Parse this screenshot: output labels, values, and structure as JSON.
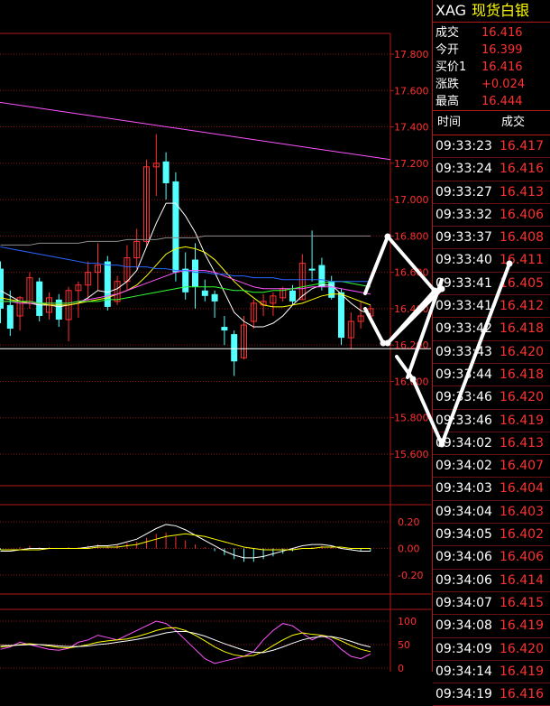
{
  "header": {
    "symbol": "XAG",
    "name": "现货白银"
  },
  "quote": [
    {
      "label": "成交",
      "value": "16.416"
    },
    {
      "label": "今开",
      "value": "16.399"
    },
    {
      "label": "买价1",
      "value": "16.416"
    },
    {
      "label": "涨跌",
      "value": "+0.024"
    },
    {
      "label": "最高",
      "value": "16.444"
    }
  ],
  "ticks_header": {
    "time": "时间",
    "price": "成交"
  },
  "ticks": [
    {
      "time": "09:33:23",
      "price": "16.417"
    },
    {
      "time": "09:33:24",
      "price": "16.416"
    },
    {
      "time": "09:33:27",
      "price": "16.413"
    },
    {
      "time": "09:33:32",
      "price": "16.406"
    },
    {
      "time": "09:33:37",
      "price": "16.408"
    },
    {
      "time": "09:33:40",
      "price": "16.411"
    },
    {
      "time": "09:33:41",
      "price": "16.405"
    },
    {
      "time": "09:33:41",
      "price": "16.412"
    },
    {
      "time": "09:33:42",
      "price": "16.418"
    },
    {
      "time": "09:33:43",
      "price": "16.420"
    },
    {
      "time": "09:33:44",
      "price": "16.418"
    },
    {
      "time": "09:33:46",
      "price": "16.420"
    },
    {
      "time": "09:33:46",
      "price": "16.419"
    },
    {
      "time": "09:34:02",
      "price": "16.413"
    },
    {
      "time": "09:34:02",
      "price": "16.407"
    },
    {
      "time": "09:34:03",
      "price": "16.404"
    },
    {
      "time": "09:34:04",
      "price": "16.403"
    },
    {
      "time": "09:34:05",
      "price": "16.402"
    },
    {
      "time": "09:34:06",
      "price": "16.406"
    },
    {
      "time": "09:34:06",
      "price": "16.414"
    },
    {
      "time": "09:34:07",
      "price": "16.415"
    },
    {
      "time": "09:34:08",
      "price": "16.419"
    },
    {
      "time": "09:34:09",
      "price": "16.420"
    },
    {
      "time": "09:34:14",
      "price": "16.419"
    },
    {
      "time": "09:34:19",
      "price": "16.416"
    }
  ],
  "chart_data": [
    {
      "type": "candlestick",
      "y_ticks": [
        "17.800",
        "17.600",
        "17.400",
        "17.200",
        "17.000",
        "16.800",
        "16.600",
        "16.400",
        "16.200",
        "16.000",
        "15.800",
        "15.600"
      ],
      "ylim": [
        15.5,
        17.95
      ],
      "colors": {
        "up": "#ff3030",
        "down": "#54ffff",
        "grid": "#8a1414"
      },
      "candles": [
        {
          "o": 16.62,
          "h": 16.66,
          "c": 16.4,
          "l": 16.32
        },
        {
          "o": 16.42,
          "h": 16.5,
          "c": 16.29,
          "l": 16.25
        },
        {
          "o": 16.36,
          "h": 16.47,
          "c": 16.46,
          "l": 16.28
        },
        {
          "o": 16.44,
          "h": 16.6,
          "c": 16.57,
          "l": 16.4
        },
        {
          "o": 16.55,
          "h": 16.57,
          "c": 16.36,
          "l": 16.33
        },
        {
          "o": 16.38,
          "h": 16.49,
          "c": 16.46,
          "l": 16.34
        },
        {
          "o": 16.45,
          "h": 16.48,
          "c": 16.34,
          "l": 16.3
        },
        {
          "o": 16.34,
          "h": 16.52,
          "c": 16.5,
          "l": 16.22
        },
        {
          "o": 16.5,
          "h": 16.55,
          "c": 16.53,
          "l": 16.35
        },
        {
          "o": 16.53,
          "h": 16.66,
          "c": 16.6,
          "l": 16.44
        },
        {
          "o": 16.6,
          "h": 16.76,
          "c": 16.64,
          "l": 16.5
        },
        {
          "o": 16.66,
          "h": 16.69,
          "c": 16.41,
          "l": 16.39
        },
        {
          "o": 16.44,
          "h": 16.58,
          "c": 16.55,
          "l": 16.42
        },
        {
          "o": 16.55,
          "h": 16.75,
          "c": 16.68,
          "l": 16.5
        },
        {
          "o": 16.68,
          "h": 16.84,
          "c": 16.77,
          "l": 16.62
        },
        {
          "o": 16.77,
          "h": 17.22,
          "c": 17.18,
          "l": 16.74
        },
        {
          "o": 17.18,
          "h": 17.36,
          "c": 17.2,
          "l": 17.02
        },
        {
          "o": 17.21,
          "h": 17.26,
          "c": 17.09,
          "l": 17.0
        },
        {
          "o": 17.1,
          "h": 17.15,
          "c": 16.6,
          "l": 16.55
        },
        {
          "o": 16.62,
          "h": 16.71,
          "c": 16.49,
          "l": 16.45
        },
        {
          "o": 16.67,
          "h": 16.76,
          "c": 16.52,
          "l": 16.4
        },
        {
          "o": 16.5,
          "h": 16.56,
          "c": 16.47,
          "l": 16.44
        },
        {
          "o": 16.48,
          "h": 16.5,
          "c": 16.44,
          "l": 16.35
        },
        {
          "o": 16.3,
          "h": 16.36,
          "c": 16.28,
          "l": 16.2
        },
        {
          "o": 16.26,
          "h": 16.28,
          "c": 16.11,
          "l": 16.03
        },
        {
          "o": 16.13,
          "h": 16.36,
          "c": 16.31,
          "l": 16.12
        },
        {
          "o": 16.33,
          "h": 16.45,
          "c": 16.43,
          "l": 16.29
        },
        {
          "o": 16.42,
          "h": 16.48,
          "c": 16.44,
          "l": 16.36
        },
        {
          "o": 16.43,
          "h": 16.49,
          "c": 16.47,
          "l": 16.36
        },
        {
          "o": 16.46,
          "h": 16.52,
          "c": 16.51,
          "l": 16.44
        },
        {
          "o": 16.5,
          "h": 16.53,
          "c": 16.44,
          "l": 16.42
        },
        {
          "o": 16.45,
          "h": 16.7,
          "c": 16.65,
          "l": 16.45
        },
        {
          "o": 16.62,
          "h": 16.83,
          "c": 16.61,
          "l": 16.55
        },
        {
          "o": 16.64,
          "h": 16.68,
          "c": 16.52,
          "l": 16.5
        },
        {
          "o": 16.55,
          "h": 16.58,
          "c": 16.46,
          "l": 16.45
        },
        {
          "o": 16.49,
          "h": 16.51,
          "c": 16.24,
          "l": 16.2
        },
        {
          "o": 16.24,
          "h": 16.38,
          "c": 16.33,
          "l": 16.18
        },
        {
          "o": 16.33,
          "h": 16.44,
          "c": 16.36,
          "l": 16.29
        },
        {
          "o": 16.36,
          "h": 16.42,
          "c": 16.4,
          "l": 16.33
        }
      ],
      "moving_averages": [
        {
          "color": "#ffffff",
          "values": [
            16.5,
            16.47,
            16.44,
            16.43,
            16.42,
            16.42,
            16.41,
            16.42,
            16.43,
            16.46,
            16.5,
            16.49,
            16.51,
            16.55,
            16.61,
            16.74,
            16.87,
            16.98,
            16.98,
            16.91,
            16.82,
            16.7,
            16.6,
            16.49,
            16.38,
            16.33,
            16.3,
            16.3,
            16.32,
            16.36,
            16.42,
            16.47,
            16.51,
            16.53,
            16.53,
            16.48,
            16.43,
            16.39,
            16.37
          ]
        },
        {
          "color": "#ffff00",
          "values": [
            16.46,
            16.45,
            16.44,
            16.43,
            16.43,
            16.42,
            16.42,
            16.42,
            16.43,
            16.44,
            16.45,
            16.46,
            16.48,
            16.5,
            16.53,
            16.58,
            16.64,
            16.7,
            16.73,
            16.74,
            16.73,
            16.71,
            16.67,
            16.61,
            16.55,
            16.5,
            16.46,
            16.42,
            16.41,
            16.41,
            16.42,
            16.43,
            16.45,
            16.47,
            16.48,
            16.48,
            16.46,
            16.44,
            16.42
          ]
        },
        {
          "color": "#ff55ff",
          "values": [
            16.44,
            16.44,
            16.43,
            16.43,
            16.43,
            16.43,
            16.43,
            16.43,
            16.44,
            16.45,
            16.46,
            16.47,
            16.48,
            16.5,
            16.52,
            16.54,
            16.56,
            16.58,
            16.6,
            16.61,
            16.61,
            16.61,
            16.6,
            16.58,
            16.56,
            16.54,
            16.52,
            16.51,
            16.51,
            16.51,
            16.51,
            16.51,
            16.52,
            16.52,
            16.52,
            16.51,
            16.5,
            16.49,
            16.48
          ]
        },
        {
          "color": "#33ff33",
          "values": [
            16.44,
            16.44,
            16.44,
            16.44,
            16.43,
            16.43,
            16.43,
            16.43,
            16.44,
            16.44,
            16.44,
            16.45,
            16.45,
            16.46,
            16.47,
            16.48,
            16.49,
            16.5,
            16.51,
            16.52,
            16.52,
            16.52,
            16.52,
            16.51,
            16.5,
            16.5,
            16.49,
            16.49,
            16.5,
            16.5,
            16.51,
            16.52,
            16.53,
            16.54,
            16.55,
            16.55,
            16.54,
            16.53,
            16.52
          ]
        },
        {
          "color": "#2b66ff",
          "values": [
            16.74,
            16.73,
            16.72,
            16.71,
            16.7,
            16.69,
            16.68,
            16.67,
            16.66,
            16.65,
            16.65,
            16.64,
            16.64,
            16.63,
            16.63,
            16.63,
            16.62,
            16.62,
            16.61,
            16.61,
            16.6,
            16.6,
            16.59,
            16.59,
            16.58,
            16.58,
            16.57,
            16.57,
            16.57,
            16.56,
            16.56,
            16.56,
            16.56,
            16.56,
            16.55,
            16.55,
            16.55,
            16.55,
            16.55
          ]
        },
        {
          "color": "#8c8c8c",
          "values": [
            16.75,
            16.75,
            16.75,
            16.75,
            16.76,
            16.76,
            16.76,
            16.76,
            16.76,
            16.77,
            16.77,
            16.77,
            16.77,
            16.78,
            16.78,
            16.78,
            16.78,
            16.79,
            16.79,
            16.79,
            16.79,
            16.8,
            16.8,
            16.8,
            16.8,
            16.8,
            16.8,
            16.8,
            16.8,
            16.8,
            16.8,
            16.8,
            16.8,
            16.8,
            16.8,
            16.8,
            16.8,
            16.8,
            16.8
          ]
        }
      ],
      "trend_lines": [
        {
          "color": "#ff55ff",
          "from": {
            "index": -2,
            "value": 17.55
          },
          "to": {
            "index": 41,
            "value": 17.22
          }
        },
        {
          "color": "#ffffff",
          "from": {
            "index": -2,
            "value": 16.18
          },
          "to": {
            "index": 41,
            "value": 16.18
          }
        }
      ]
    },
    {
      "type": "macd",
      "y_ticks": [
        "0.20",
        "0.00",
        "-0.20"
      ],
      "ylim": [
        -0.3,
        0.3
      ],
      "histogram": [
        -0.01,
        0.0,
        0.01,
        0.02,
        0.01,
        0.01,
        0.0,
        0.01,
        0.01,
        0.02,
        0.03,
        0.02,
        0.03,
        0.04,
        0.05,
        0.08,
        0.11,
        0.12,
        0.09,
        0.06,
        0.03,
        0.01,
        -0.02,
        -0.05,
        -0.08,
        -0.1,
        -0.1,
        -0.08,
        -0.06,
        -0.04,
        -0.02,
        0.0,
        0.01,
        0.02,
        0.02,
        0.0,
        -0.01,
        -0.02,
        -0.02
      ],
      "lines": [
        {
          "color": "#ffffff",
          "values": [
            -0.02,
            -0.02,
            -0.01,
            0.0,
            0.0,
            0.0,
            0.0,
            0.0,
            0.0,
            0.01,
            0.02,
            0.02,
            0.03,
            0.05,
            0.07,
            0.11,
            0.15,
            0.18,
            0.17,
            0.14,
            0.1,
            0.06,
            0.02,
            -0.02,
            -0.05,
            -0.07,
            -0.07,
            -0.06,
            -0.04,
            -0.02,
            0.0,
            0.02,
            0.03,
            0.03,
            0.02,
            0.0,
            -0.01,
            -0.02,
            -0.02
          ]
        },
        {
          "color": "#ffff00",
          "values": [
            -0.01,
            -0.01,
            -0.01,
            -0.01,
            -0.01,
            0.0,
            0.0,
            0.0,
            0.0,
            0.0,
            0.01,
            0.01,
            0.01,
            0.02,
            0.03,
            0.05,
            0.07,
            0.09,
            0.1,
            0.11,
            0.1,
            0.09,
            0.07,
            0.05,
            0.03,
            0.01,
            0.0,
            -0.01,
            -0.01,
            -0.01,
            -0.01,
            0.0,
            0.0,
            0.01,
            0.01,
            0.01,
            0.0,
            0.0,
            0.0
          ]
        }
      ]
    },
    {
      "type": "oscillator",
      "y_ticks": [
        "100",
        "50",
        "0"
      ],
      "ylim": [
        0,
        100
      ],
      "lines": [
        {
          "color": "#ff55ff",
          "values": [
            40,
            45,
            55,
            50,
            45,
            40,
            38,
            42,
            55,
            60,
            70,
            65,
            60,
            70,
            80,
            90,
            100,
            95,
            80,
            60,
            40,
            20,
            10,
            15,
            20,
            25,
            35,
            60,
            80,
            95,
            90,
            75,
            60,
            70,
            60,
            40,
            25,
            20,
            30
          ]
        },
        {
          "color": "#ffff00",
          "values": [
            45,
            47,
            50,
            52,
            50,
            47,
            44,
            43,
            46,
            50,
            55,
            58,
            60,
            62,
            67,
            73,
            80,
            85,
            86,
            80,
            70,
            58,
            45,
            35,
            28,
            25,
            27,
            35,
            48,
            60,
            70,
            75,
            72,
            70,
            66,
            58,
            48,
            40,
            35
          ]
        },
        {
          "color": "#ffffff",
          "values": [
            48,
            48,
            49,
            50,
            50,
            49,
            47,
            46,
            46,
            47,
            50,
            52,
            55,
            58,
            61,
            65,
            70,
            75,
            78,
            78,
            74,
            68,
            60,
            52,
            45,
            38,
            34,
            33,
            38,
            45,
            53,
            60,
            65,
            67,
            67,
            63,
            57,
            50,
            45
          ]
        }
      ]
    }
  ],
  "annotations": {
    "arrow_color": "#ffffff"
  }
}
